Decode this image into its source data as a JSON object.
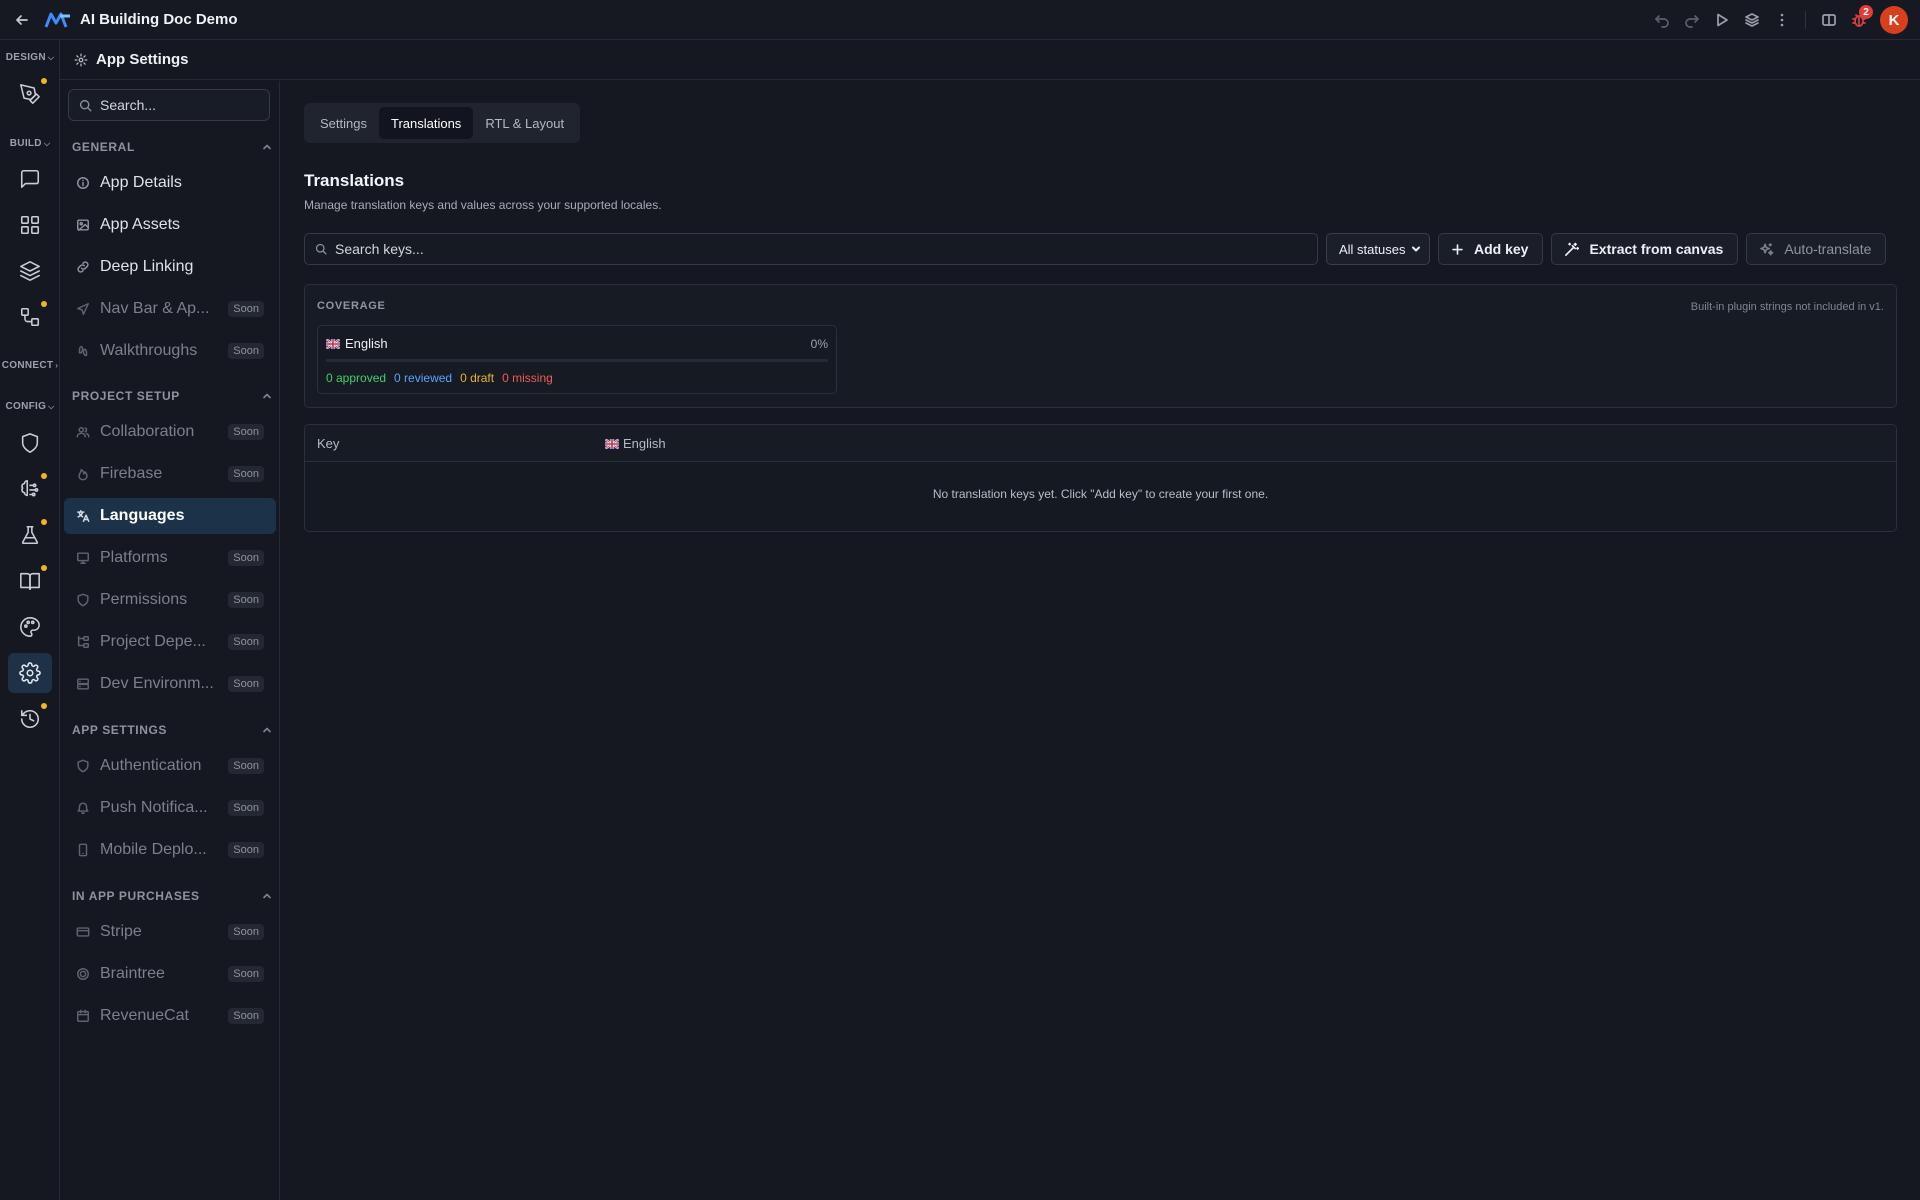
{
  "topbar": {
    "title": "AI Building Doc Demo",
    "notification_count": "2",
    "avatar_initial": "K"
  },
  "rail": {
    "sections": {
      "design": "DESIGN",
      "build": "BUILD",
      "connect": "CONNECT",
      "config": "CONFIG"
    }
  },
  "sidebar": {
    "header": "App Settings",
    "search_placeholder": "Search...",
    "soon_label": "Soon",
    "sections": {
      "general": "GENERAL",
      "project_setup": "PROJECT SETUP",
      "app_settings": "APP SETTINGS",
      "in_app_purchases": "IN APP PURCHASES"
    },
    "items": {
      "app_details": "App Details",
      "app_assets": "App Assets",
      "deep_linking": "Deep Linking",
      "nav_bar": "Nav Bar & Ap...",
      "walkthroughs": "Walkthroughs",
      "collaboration": "Collaboration",
      "firebase": "Firebase",
      "languages": "Languages",
      "platforms": "Platforms",
      "permissions": "Permissions",
      "project_dependencies": "Project Depe...",
      "dev_environments": "Dev Environm...",
      "authentication": "Authentication",
      "push_notifications": "Push Notifica...",
      "mobile_deploy": "Mobile Deplo...",
      "stripe": "Stripe",
      "braintree": "Braintree",
      "revenuecat": "RevenueCat"
    }
  },
  "main": {
    "tabs": {
      "settings": "Settings",
      "translations": "Translations",
      "rtl_layout": "RTL & Layout"
    },
    "title": "Translations",
    "subtitle": "Manage translation keys and values across your supported locales.",
    "search_placeholder": "Search keys...",
    "status_filter": "All statuses",
    "add_key": "Add key",
    "extract": "Extract from canvas",
    "auto_translate": "Auto-translate",
    "coverage": {
      "title": "COVERAGE",
      "note": "Built-in plugin strings not included in v1.",
      "language": "English",
      "percent_label": "0%",
      "progress": 0,
      "approved": "0 approved",
      "reviewed": "0 reviewed",
      "draft": "0 draft",
      "missing": "0 missing"
    },
    "table": {
      "col_key": "Key",
      "col_english": "English",
      "empty": "No translation keys yet. Click \"Add key\" to create your first one."
    }
  },
  "colors": {
    "accent": "#1c3249",
    "approved": "#3ecf6e",
    "reviewed": "#5aa2ff",
    "draft": "#e8b32a",
    "missing": "#ef5a5a",
    "avatar": "#d8401d",
    "dot": "#f2b51c"
  }
}
